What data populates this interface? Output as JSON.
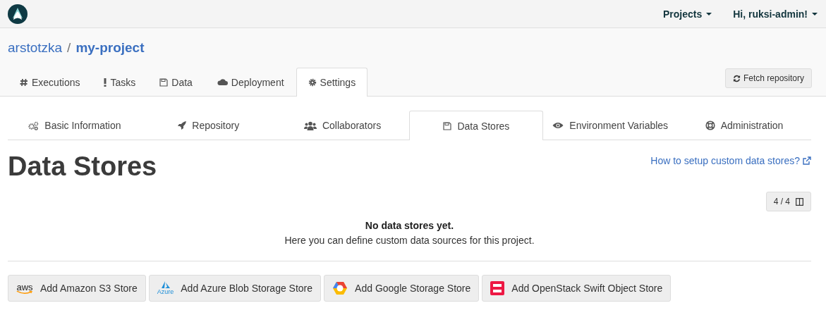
{
  "navbar": {
    "menus": [
      "Projects",
      "Hi, ruksi-admin!"
    ]
  },
  "breadcrumb": {
    "owner": "arstotzka",
    "separator": "/",
    "project": "my-project"
  },
  "tabs": [
    {
      "label": "Executions",
      "selected": false
    },
    {
      "label": "Tasks",
      "selected": false
    },
    {
      "label": "Data",
      "selected": false
    },
    {
      "label": "Deployment",
      "selected": false
    },
    {
      "label": "Settings",
      "selected": true
    }
  ],
  "fetch_button": "Fetch repository",
  "settings_tabs": [
    {
      "label": "Basic Information",
      "selected": false
    },
    {
      "label": "Repository",
      "selected": false
    },
    {
      "label": "Collaborators",
      "selected": false
    },
    {
      "label": "Data Stores",
      "selected": true
    },
    {
      "label": "Environment Variables",
      "selected": false
    },
    {
      "label": "Administration",
      "selected": false
    }
  ],
  "heading": "Data Stores",
  "help_link": "How to setup custom data stores?",
  "column_toggle": "4 / 4",
  "empty_title": "No data stores yet.",
  "empty_text": "Here you can define custom data sources for this project.",
  "add_buttons": [
    {
      "label": "Add Amazon S3 Store",
      "logo_text": "aws"
    },
    {
      "label": "Add Azure Blob Storage Store",
      "logo_text": "Azure"
    },
    {
      "label": "Add Google Storage Store"
    },
    {
      "label": "Add OpenStack Swift Object Store"
    }
  ]
}
